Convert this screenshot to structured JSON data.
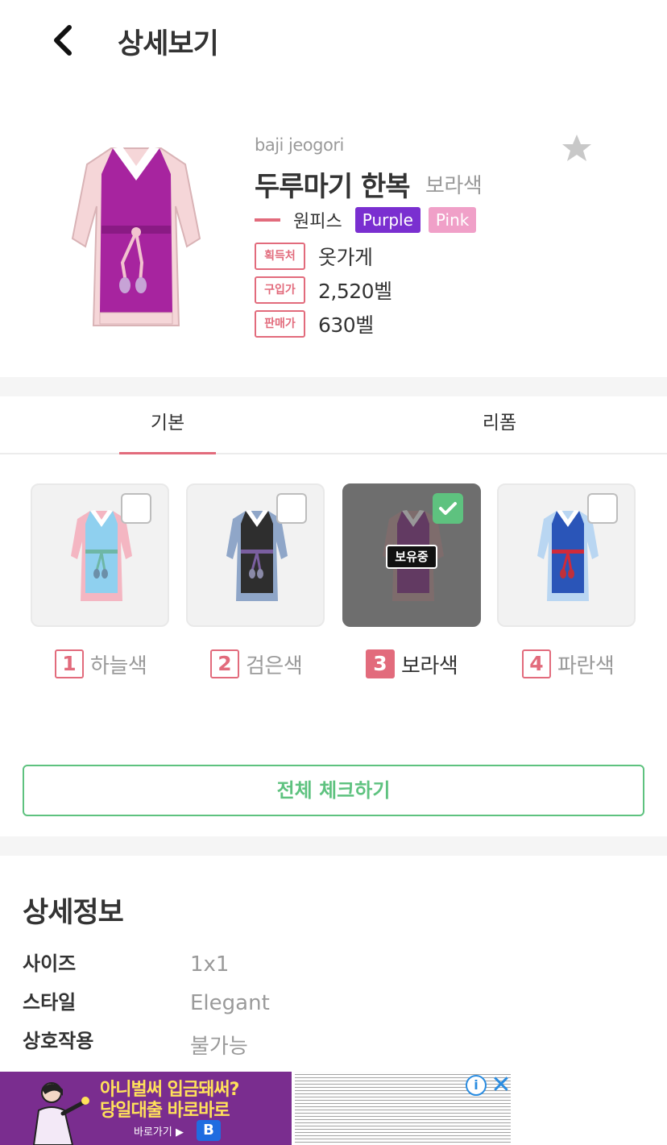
{
  "header": {
    "title": "상세보기",
    "back_icon": "chevron-left-icon"
  },
  "item": {
    "english_name": "baji jeogori",
    "name": "두루마기 한복",
    "variant": "보라색",
    "category": "원피스",
    "color_tags": [
      {
        "label": "Purple",
        "color": "#7a2fd0"
      },
      {
        "label": "Pink",
        "color": "#f0a0c8"
      }
    ],
    "favorite_icon": "star-icon",
    "info": [
      {
        "badge": "획득처",
        "value": "옷가게"
      },
      {
        "badge": "구입가",
        "value": "2,520벨"
      },
      {
        "badge": "판매가",
        "value": "630벨"
      }
    ]
  },
  "tabs": [
    {
      "label": "기본",
      "active": true
    },
    {
      "label": "리폼",
      "active": false
    }
  ],
  "variants": [
    {
      "num": "1",
      "name": "하늘색",
      "checked": false,
      "owned": false
    },
    {
      "num": "2",
      "name": "검은색",
      "checked": false,
      "owned": false
    },
    {
      "num": "3",
      "name": "보라색",
      "checked": true,
      "owned": true,
      "owned_label": "보유중"
    },
    {
      "num": "4",
      "name": "파란색",
      "checked": false,
      "owned": false
    }
  ],
  "check_all_label": "전체 체크하기",
  "details": {
    "title": "상세정보",
    "rows": [
      {
        "label": "사이즈",
        "value": "1x1"
      },
      {
        "label": "스타일",
        "value": "Elegant"
      },
      {
        "label": "상호작용",
        "value": "불가능"
      }
    ]
  },
  "ad": {
    "line1": "아니벌써 입금돼써?",
    "line2": "당일대출 바로바로",
    "cta": "바로가기 ▶",
    "logo": "B",
    "info_icon": "info-icon",
    "close_icon": "close-icon"
  },
  "colors": {
    "accent": "#e26b7c",
    "green": "#5ec27f"
  }
}
